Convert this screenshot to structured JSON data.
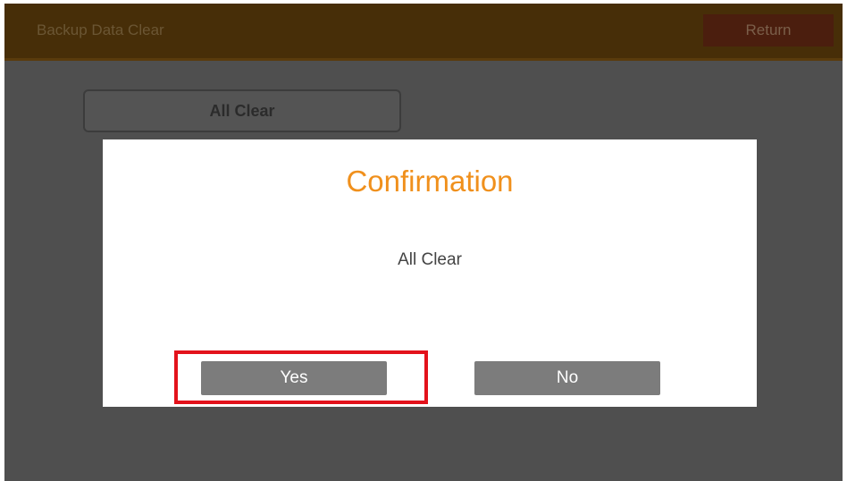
{
  "header": {
    "title": "Backup Data Clear",
    "return_label": "Return"
  },
  "main": {
    "all_clear_label": "All Clear"
  },
  "dialog": {
    "title": "Confirmation",
    "message": "All Clear",
    "yes_label": "Yes",
    "no_label": "No"
  },
  "colors": {
    "header_bg": "#472e08",
    "dialog_title": "#f0901c",
    "highlight": "#e3121b",
    "button_bg": "#7c7c7c",
    "overlay_bg": "#4f4f4f"
  }
}
